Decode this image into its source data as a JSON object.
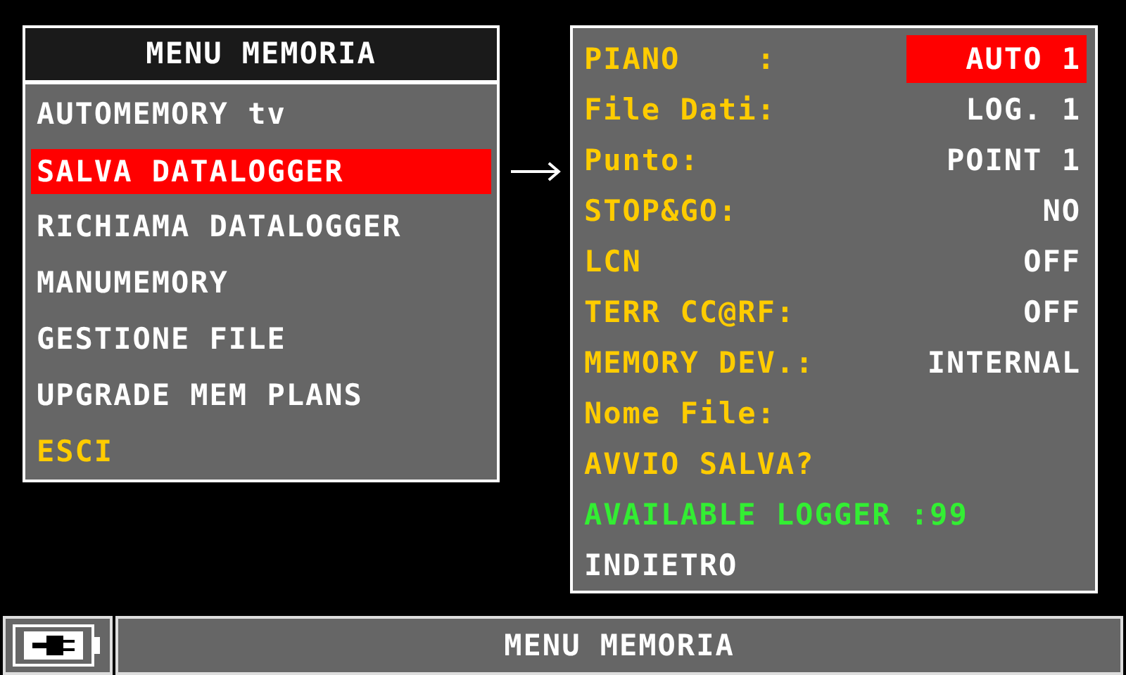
{
  "menu": {
    "title": "MENU MEMORIA",
    "items": [
      {
        "label": "AUTOMEMORY tv",
        "kind": "entry",
        "selected": false
      },
      {
        "label": "SALVA DATALOGGER",
        "kind": "entry",
        "selected": true
      },
      {
        "label": "RICHIAMA DATALOGGER",
        "kind": "entry",
        "selected": false
      },
      {
        "label": "MANUMEMORY",
        "kind": "entry",
        "selected": false
      },
      {
        "label": "GESTIONE FILE",
        "kind": "entry",
        "selected": false
      },
      {
        "label": "UPGRADE MEM PLANS",
        "kind": "entry",
        "selected": false
      },
      {
        "label": "ESCI",
        "kind": "exit",
        "selected": false
      }
    ]
  },
  "settings": {
    "rows": [
      {
        "label": "PIANO    :",
        "value": "AUTO 1",
        "kind": "setting",
        "selected": true
      },
      {
        "label": "File Dati:",
        "value": "LOG. 1",
        "kind": "setting",
        "selected": false
      },
      {
        "label": "Punto:",
        "value": "POINT 1",
        "kind": "setting",
        "selected": false
      },
      {
        "label": "STOP&GO:",
        "value": "NO",
        "kind": "setting",
        "selected": false
      },
      {
        "label": "LCN",
        "value": "OFF",
        "kind": "setting",
        "selected": false
      },
      {
        "label": "TERR CC@RF:",
        "value": "OFF",
        "kind": "setting",
        "selected": false
      },
      {
        "label": "MEMORY DEV.:",
        "value": "INTERNAL",
        "kind": "setting",
        "selected": false
      },
      {
        "label": "Nome File:",
        "kind": "setting",
        "selected": false
      },
      {
        "label": "AVVIO SALVA?",
        "kind": "action",
        "selected": false
      },
      {
        "label": "AVAILABLE LOGGER :99",
        "kind": "info",
        "selected": false
      },
      {
        "label": "INDIETRO",
        "kind": "back",
        "selected": false
      }
    ]
  },
  "status_bar": {
    "title": "MENU MEMORIA"
  }
}
